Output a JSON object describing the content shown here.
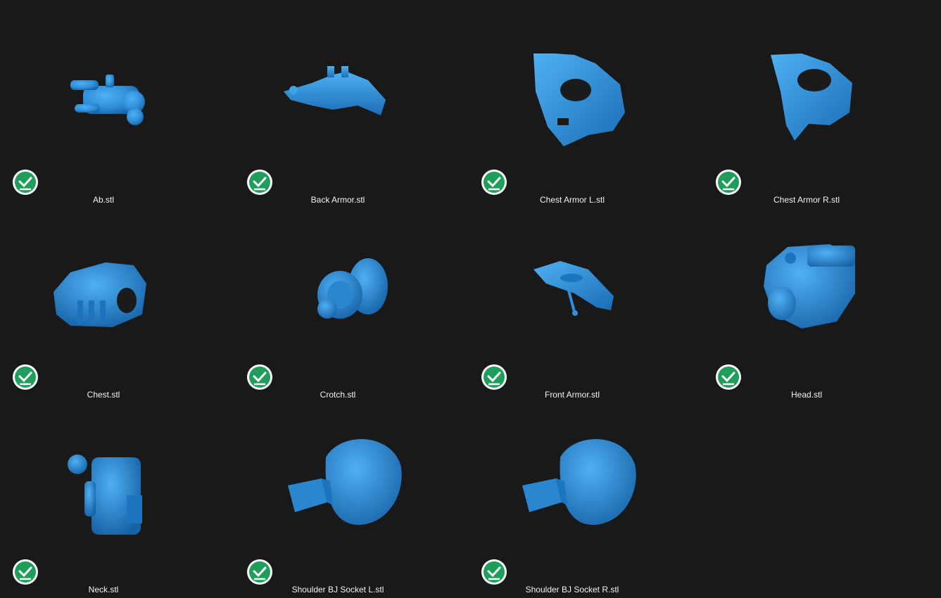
{
  "files": [
    {
      "name": "Ab.stl",
      "icon": "ab-model-thumbnail-icon",
      "status": "synced-check-icon"
    },
    {
      "name": "Back Armor.stl",
      "icon": "back-armor-model-thumbnail-icon",
      "status": "synced-check-icon"
    },
    {
      "name": "Chest Armor L.stl",
      "icon": "chest-armor-l-model-thumbnail-icon",
      "status": "synced-check-icon"
    },
    {
      "name": "Chest Armor R.stl",
      "icon": "chest-armor-r-model-thumbnail-icon",
      "status": "synced-check-icon"
    },
    {
      "name": "Chest.stl",
      "icon": "chest-model-thumbnail-icon",
      "status": "synced-check-icon"
    },
    {
      "name": "Crotch.stl",
      "icon": "crotch-model-thumbnail-icon",
      "status": "synced-check-icon"
    },
    {
      "name": "Front Armor.stl",
      "icon": "front-armor-model-thumbnail-icon",
      "status": "synced-check-icon"
    },
    {
      "name": "Head.stl",
      "icon": "head-model-thumbnail-icon",
      "status": "synced-check-icon"
    },
    {
      "name": "Neck.stl",
      "icon": "neck-model-thumbnail-icon",
      "status": "synced-check-icon"
    },
    {
      "name": "Shoulder BJ Socket L.stl",
      "icon": "shoulder-socket-l-model-thumbnail-icon",
      "status": "synced-check-icon"
    },
    {
      "name": "Shoulder BJ Socket R.stl",
      "icon": "shoulder-socket-r-model-thumbnail-icon",
      "status": "synced-check-icon"
    }
  ],
  "colors": {
    "background": "#191919",
    "model_blue": "#2f8fd8",
    "status_green": "#1e9e5a",
    "label_text": "#f2f2f2"
  }
}
